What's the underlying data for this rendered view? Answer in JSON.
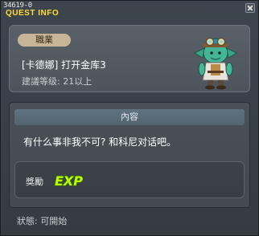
{
  "window": {
    "quest_id": "34619-0",
    "title": "QUEST INFO"
  },
  "header": {
    "job_badge": "職業",
    "quest_name": "[卡德娜] 打开金库3",
    "recommended_level": "建議等级: 21以上",
    "npc_portrait": "green-goblin-npc-portrait"
  },
  "content": {
    "header": "內容",
    "text": "有什么事非我不可? 和科尼对话吧。"
  },
  "reward": {
    "label": "獎勵",
    "icon": "exp-icon"
  },
  "status": "狀態: 可開始",
  "colors": {
    "title": "#ffdd33",
    "exp_fill": "#b8ff00",
    "exp_outline": "#3a6a00"
  }
}
